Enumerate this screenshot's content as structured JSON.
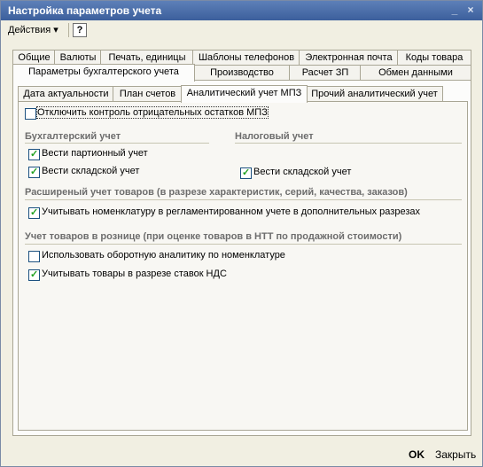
{
  "window": {
    "title": "Настройка параметров учета"
  },
  "titlebar_icons": {
    "minimize": "minimize-icon",
    "close": "close-icon"
  },
  "toolbar": {
    "actions_label": "Действия",
    "help_label": "?"
  },
  "tabs_row1": [
    "Общие",
    "Валюты",
    "Печать, единицы",
    "Шаблоны телефонов",
    "Электронная почта",
    "Коды товара"
  ],
  "tabs_row2": [
    "Параметры бухгалтерского учета",
    "Производство",
    "Расчет ЗП",
    "Обмен данными"
  ],
  "subtabs": [
    "Дата актуальности",
    "План счетов",
    "Аналитический учет МПЗ",
    "Прочий аналитический учет"
  ],
  "options": {
    "disable_negative_control": {
      "label": "Отключить контроль отрицательных остатков МПЗ",
      "checked": false
    },
    "buh_group": "Бухгалтерский учет",
    "tax_group": "Налоговый учет",
    "buh_batch": {
      "label": "Вести партионный учет",
      "checked": true
    },
    "buh_warehouse": {
      "label": "Вести складской учет",
      "checked": true
    },
    "tax_warehouse": {
      "label": "Вести складской учет",
      "checked": true
    },
    "ext_group": "Расширеный учет товаров (в разрезе характеристик, серий, качества, заказов)",
    "ext_nomenclature": {
      "label": "Учитывать номенклатуру в регламентированном учете в дополнительных разрезах",
      "checked": true
    },
    "retail_group": "Учет товаров в рознице (при оценке товаров в НТТ по продажной стоимости)",
    "retail_turnover": {
      "label": "Использовать оборотную аналитику по номенклатуре",
      "checked": false
    },
    "retail_vat": {
      "label": "Учитывать товары в разрезе ставок НДС",
      "checked": true
    }
  },
  "footer": {
    "ok_label": "OK",
    "close_label": "Закрыть"
  }
}
